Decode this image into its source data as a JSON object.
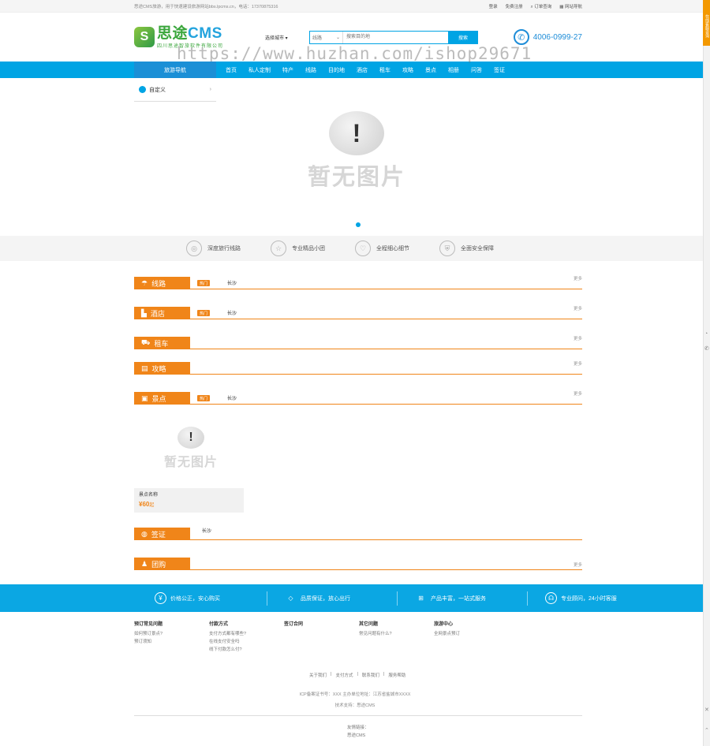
{
  "topbar": {
    "notice": "思途CMS旅游，用于快速建设旅游网站bbs.lpcms.cn，电话：17370875316",
    "links": [
      "登录",
      "免费注册",
      "订单查询",
      "网站导航"
    ]
  },
  "header": {
    "logo_name_green": "思途",
    "logo_name_blue": "CMS",
    "logo_sub": "四川思途智旅软件有限公司",
    "city_label": "选择城市 ▾",
    "search_type": "线路",
    "search_placeholder": "搜索目的地",
    "search_button": "搜索",
    "phone": "4006-0999-27",
    "watermark": "https://www.huzhan.com/ishop29671"
  },
  "nav": {
    "guide": "旅游导航",
    "items": [
      "首页",
      "私人定制",
      "特产",
      "线路",
      "目的地",
      "酒店",
      "租车",
      "攻略",
      "景点",
      "相册",
      "问答",
      "签证"
    ]
  },
  "banner": {
    "sidecat_label": "自定义",
    "noimg_text": "暂无图片"
  },
  "features": [
    "深度旅行线路",
    "专业精品小团",
    "全程细心细节",
    "全面安全保障"
  ],
  "sections": {
    "line": {
      "title": "线路",
      "hot": "热门",
      "city": "长沙",
      "more": "更多"
    },
    "hotel": {
      "title": "酒店",
      "hot": "热门",
      "city": "长沙",
      "more": "更多"
    },
    "car": {
      "title": "租车",
      "more": "更多"
    },
    "guide": {
      "title": "攻略",
      "more": "更多"
    },
    "spot": {
      "title": "景点",
      "hot": "热门",
      "city": "长沙",
      "more": "更多"
    },
    "visa": {
      "title": "签证",
      "city": "长沙"
    },
    "group": {
      "title": "团购",
      "more": "更多"
    }
  },
  "spot_card": {
    "noimg_text": "暂无图片",
    "name": "景点名称",
    "price": "¥60",
    "price_unit": "起"
  },
  "promise": [
    "价格公正，安心购买",
    "品质保证，放心出行",
    "产品丰富，一站式服务",
    "专业顾问，24小时客服"
  ],
  "footer": {
    "columns": [
      {
        "title": "预订常见问题",
        "items": [
          "如何预订景点?",
          "预订须知"
        ]
      },
      {
        "title": "付款方式",
        "items": [
          "支付方式都有哪些?",
          "在线支付安全吗",
          "线下付款怎么付?"
        ]
      },
      {
        "title": "签订合同",
        "items": []
      },
      {
        "title": "其它问题",
        "items": [
          "常见问题有什么?"
        ]
      },
      {
        "title": "旅游中心",
        "items": [
          "全网景点预订"
        ]
      }
    ],
    "links": [
      "关于我们",
      "|",
      "支付方式",
      "|",
      "联系我们",
      "|",
      "服务帮助"
    ],
    "record": "ICP备案证书号：XXX    主办单位地址：江苏省盐城市XXXX",
    "support": "技术支持：思途CMS",
    "friend_title": "友情链接：",
    "friend_link": "思途CMS"
  },
  "sidebar_right": {
    "tab": "在线客服咨询"
  }
}
